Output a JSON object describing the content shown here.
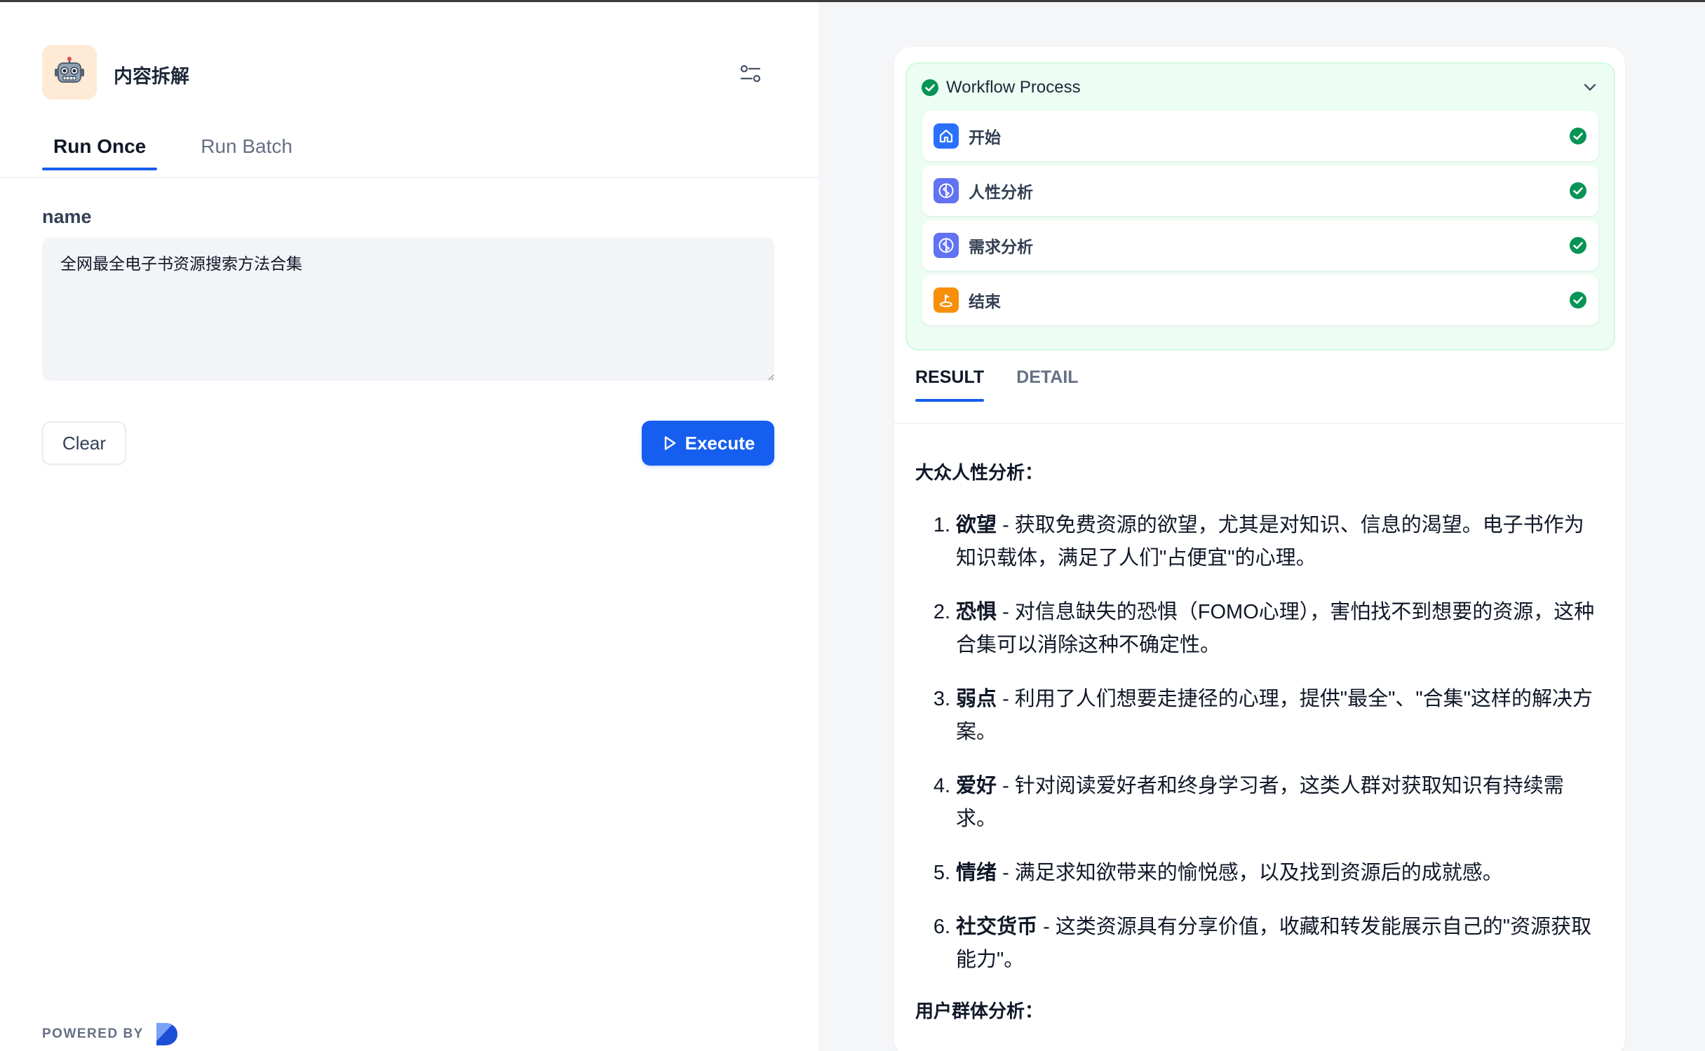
{
  "app": {
    "title": "内容拆解",
    "icon": "robot-icon"
  },
  "tabs": [
    {
      "label": "Run Once",
      "active": true
    },
    {
      "label": "Run Batch",
      "active": false
    }
  ],
  "form": {
    "field_label": "name",
    "field_value": "全网最全电子书资源搜索方法合集",
    "clear_label": "Clear",
    "execute_label": "Execute"
  },
  "footer": {
    "powered_by": "POWERED BY"
  },
  "workflow": {
    "title": "Workflow Process",
    "status": "success",
    "nodes": [
      {
        "label": "开始",
        "icon": "home-icon",
        "color": "#2970ff",
        "status": "success"
      },
      {
        "label": "人性分析",
        "icon": "llm-icon",
        "color": "#6172f3",
        "status": "success"
      },
      {
        "label": "需求分析",
        "icon": "llm-icon",
        "color": "#6172f3",
        "status": "success"
      },
      {
        "label": "结束",
        "icon": "flag-icon",
        "color": "#f79009",
        "status": "success"
      }
    ]
  },
  "result_tabs": [
    {
      "label": "RESULT",
      "active": true
    },
    {
      "label": "DETAIL",
      "active": false
    }
  ],
  "result": {
    "heading1": "大众人性分析：",
    "items": [
      {
        "num": "1.",
        "term": "欲望",
        "text": " - 获取免费资源的欲望，尤其是对知识、信息的渴望。电子书作为知识载体，满足了人们\"占便宜\"的心理。"
      },
      {
        "num": "2.",
        "term": "恐惧",
        "text": " - 对信息缺失的恐惧（FOMO心理），害怕找不到想要的资源，这种合集可以消除这种不确定性。"
      },
      {
        "num": "3.",
        "term": "弱点",
        "text": " - 利用了人们想要走捷径的心理，提供\"最全\"、\"合集\"这样的解决方案。"
      },
      {
        "num": "4.",
        "term": "爱好",
        "text": " - 针对阅读爱好者和终身学习者，这类人群对获取知识有持续需求。"
      },
      {
        "num": "5.",
        "term": "情绪",
        "text": " - 满足求知欲带来的愉悦感，以及找到资源后的成就感。"
      },
      {
        "num": "6.",
        "term": "社交货币",
        "text": " - 这类资源具有分享价值，收藏和转发能展示自己的\"资源获取能力\"。"
      }
    ],
    "heading2": "用户群体分析："
  },
  "colors": {
    "accent": "#155eef",
    "success": "#12b76a",
    "workflow_bg": "#ecfdf3"
  }
}
